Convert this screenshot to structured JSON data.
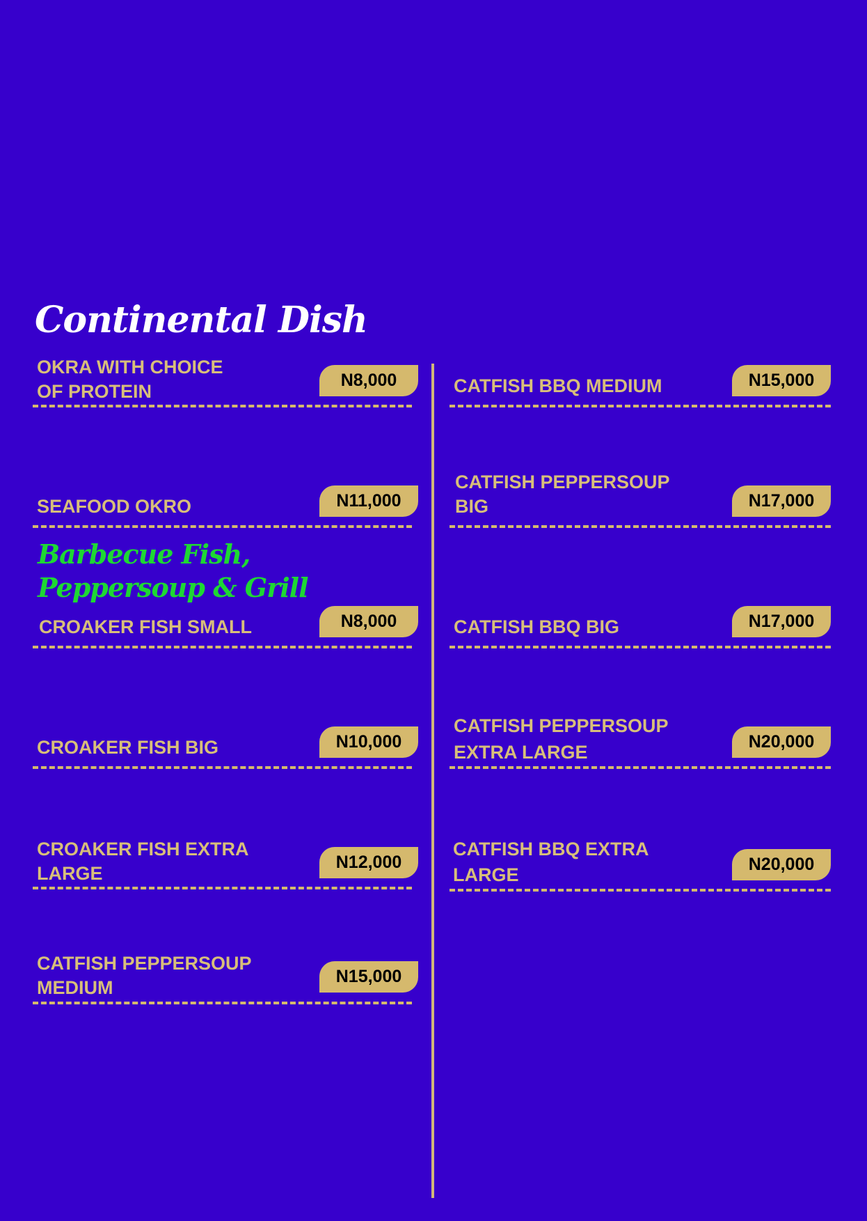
{
  "sections": {
    "continental_title": "Continental Dish",
    "bbq_title": "Barbecue Fish, Peppersoup & Grill"
  },
  "left_items": [
    {
      "name": "OKRA WITH CHOICE\nOF PROTEIN",
      "price": "N8,000"
    },
    {
      "name": "SEAFOOD OKRO",
      "price": "N11,000"
    },
    {
      "name": "CROAKER FISH SMALL",
      "price": "N8,000"
    },
    {
      "name": "CROAKER FISH BIG",
      "price": "N10,000"
    },
    {
      "name": "CROAKER FISH EXTRA\nLARGE",
      "price": "N12,000"
    },
    {
      "name": "CATFISH PEPPERSOUP\nMEDIUM",
      "price": "N15,000"
    }
  ],
  "right_items": [
    {
      "name": "CATFISH BBQ MEDIUM",
      "price": "N15,000"
    },
    {
      "name": "CATFISH PEPPERSOUP\nBIG",
      "price": "N17,000"
    },
    {
      "name": "CATFISH BBQ BIG",
      "price": "N17,000"
    },
    {
      "name": "CATFISH PEPPERSOUP\nEXTRA LARGE",
      "price": "N20,000"
    },
    {
      "name": "CATFISH BBQ EXTRA\nLARGE",
      "price": "N20,000"
    }
  ],
  "colors": {
    "background": "#3700cc",
    "gold": "#d5b96d",
    "item_text": "#d8be7a",
    "section_white": "#ffffff",
    "section_green": "#1ed833"
  }
}
